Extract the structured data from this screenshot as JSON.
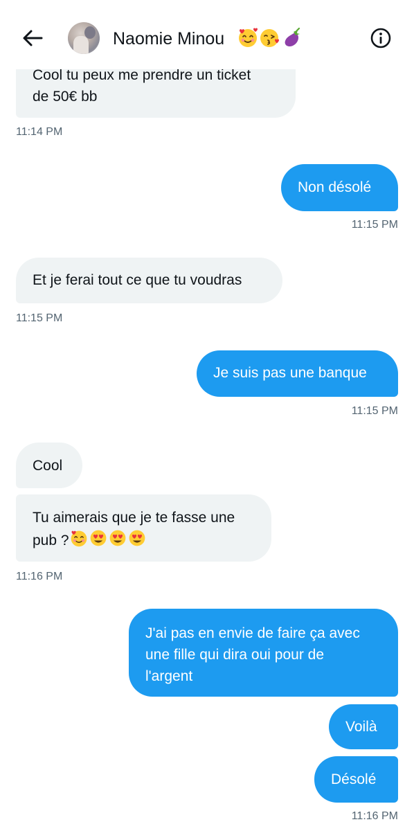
{
  "header": {
    "contact_name": "Naomie Minou",
    "name_emojis": [
      "smiling-face-with-hearts",
      "face-blowing-kiss",
      "eggplant"
    ]
  },
  "messages": [
    {
      "side": "in",
      "text_line1": "Cool tu peux me prendre un ticket",
      "text_line2": "de 50€ bb",
      "time": "11:14 PM"
    },
    {
      "side": "out",
      "text": "Non désolé",
      "time": "11:15 PM"
    },
    {
      "side": "in",
      "text": "Et je ferai tout ce que tu voudras",
      "time": "11:15 PM"
    },
    {
      "side": "out",
      "text": "Je suis pas une banque",
      "time": "11:15 PM"
    },
    {
      "side": "in",
      "text": "Cool"
    },
    {
      "side": "in",
      "text_line1": "Tu aimerais que je te fasse une",
      "text_line2": "pub ?",
      "emojis": [
        "smiling-face-with-hearts",
        "heart-eyes",
        "heart-eyes",
        "heart-eyes"
      ],
      "time": "11:16 PM"
    },
    {
      "side": "out",
      "text_line1": "J'ai pas en envie de faire ça avec",
      "text_line2": "une fille qui dira oui pour de",
      "text_line3": "l'argent"
    },
    {
      "side": "out",
      "text": "Voilà"
    },
    {
      "side": "out",
      "text": "Désolé",
      "time": "11:16 PM"
    }
  ],
  "colors": {
    "outgoing_bubble": "#1d9bf0",
    "incoming_bubble": "#eff3f4",
    "timestamp": "#536471",
    "text": "#0f1419"
  },
  "icons": {
    "back": "arrow-left-icon",
    "info": "info-circle-icon"
  }
}
